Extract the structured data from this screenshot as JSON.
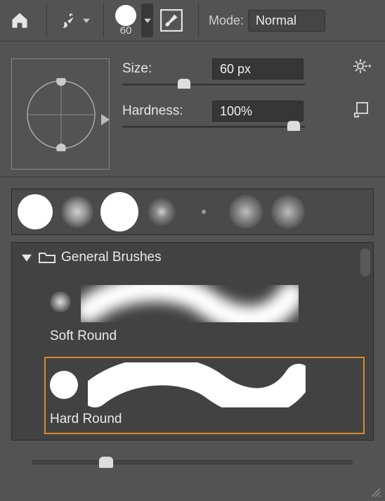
{
  "toolbar": {
    "brush_size_label": "60",
    "mode_label": "Mode:",
    "mode_value": "Normal"
  },
  "props": {
    "size_label": "Size:",
    "size_value": "60 px",
    "size_pct": 34,
    "hardness_label": "Hardness:",
    "hardness_value": "100%",
    "hardness_pct": 94
  },
  "folder": {
    "title": "General Brushes",
    "items": [
      {
        "name": "Soft Round",
        "selected": false,
        "type": "soft"
      },
      {
        "name": "Hard Round",
        "selected": true,
        "type": "hard"
      }
    ]
  },
  "bottom_slider": {
    "pct": 23
  }
}
